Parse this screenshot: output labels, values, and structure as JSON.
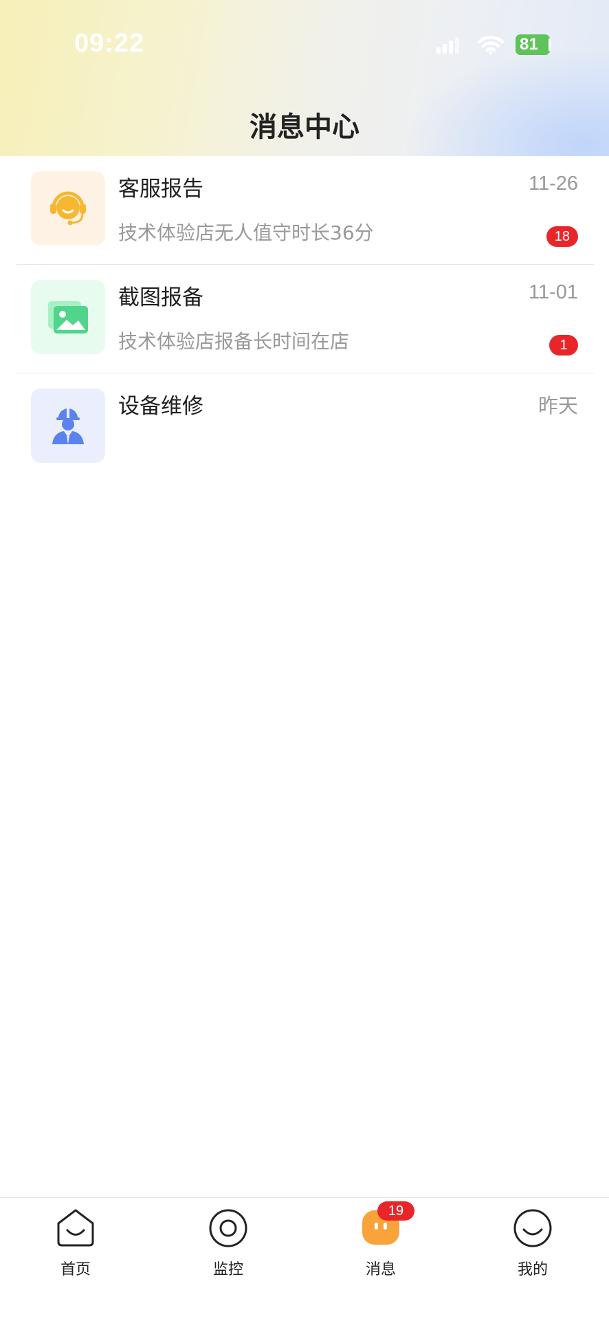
{
  "status_bar": {
    "time": "09:22",
    "battery": "81"
  },
  "header": {
    "title": "消息中心"
  },
  "messages": [
    {
      "title": "客服报告",
      "time": "11-26",
      "subtitle": "技术体验店无人值守时长36分",
      "badge": "18",
      "icon": "headset-agent-icon",
      "icon_bg": "#fdf2e3",
      "icon_color": "#f7b731"
    },
    {
      "title": "截图报备",
      "time": "11-01",
      "subtitle": "技术体验店报备长时间在店",
      "badge": "1",
      "icon": "picture-gallery-icon",
      "icon_bg": "#e8fbef",
      "icon_color": "#4fd68a"
    },
    {
      "title": "设备维修",
      "time": "昨天",
      "subtitle": "",
      "badge": "",
      "icon": "repair-worker-icon",
      "icon_bg": "#eaeefd",
      "icon_color": "#5b82ee"
    }
  ],
  "tabbar": {
    "items": [
      {
        "label": "首页",
        "icon": "home-icon"
      },
      {
        "label": "监控",
        "icon": "monitor-icon"
      },
      {
        "label": "消息",
        "icon": "message-icon",
        "active_color": "#f9a43a"
      },
      {
        "label": "我的",
        "icon": "profile-icon"
      }
    ],
    "message_badge": "19"
  },
  "colors": {
    "badge": "#e8262a",
    "battery": "#5fc35a"
  }
}
